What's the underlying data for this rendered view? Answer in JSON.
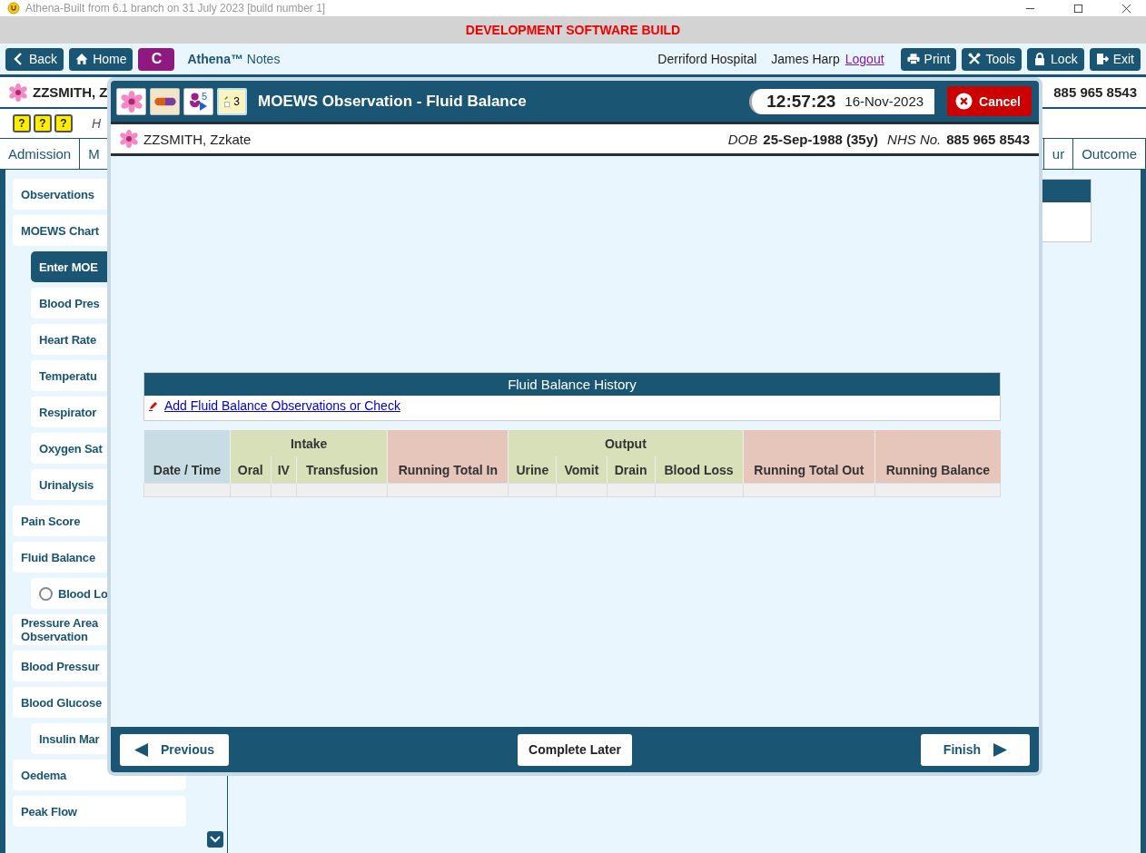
{
  "app_title": "Athena-Built from 6.1 branch on 31 July 2023 [build number 1]",
  "banner": "DEVELOPMENT SOFTWARE BUILD",
  "toolbar": {
    "nav_buttons": [
      {
        "kind": "back",
        "label": "Back"
      },
      {
        "kind": "home",
        "label": "Home"
      }
    ],
    "c_button": "C",
    "brand": "Athena™",
    "brand_suffix": "Notes",
    "hospital": "Derriford Hospital",
    "user": "James Harp",
    "logout": "Logout",
    "actions": [
      {
        "kind": "print",
        "label": "Print"
      },
      {
        "kind": "tools",
        "label": "Tools"
      },
      {
        "kind": "lock",
        "label": "Lock"
      },
      {
        "kind": "exit",
        "label": "Exit"
      }
    ]
  },
  "patient_bar": {
    "name": "ZZSMITH, Z",
    "nhs": "885 965 8543"
  },
  "alert_row": {
    "help_marks": [
      "?",
      "?",
      "?"
    ],
    "note": "H"
  },
  "tabs": [
    {
      "label": "Admission",
      "selected": false
    },
    {
      "label": "M",
      "selected": false
    },
    {
      "label": "ur",
      "selected": false
    },
    {
      "label": "Outcome",
      "selected": false
    }
  ],
  "sidebar": {
    "items": [
      {
        "label": "Observations",
        "selected": false
      },
      {
        "label": "MOEWS Chart",
        "selected": false,
        "children": [
          {
            "label": "Enter MOE",
            "selected": true
          },
          {
            "label": "Blood Pres",
            "selected": false
          },
          {
            "label": "Heart Rate",
            "selected": false
          },
          {
            "label": "Temperatu",
            "selected": false
          },
          {
            "label": "Respirator",
            "selected": false
          },
          {
            "label": "Oxygen Sat",
            "selected": false
          },
          {
            "label": "Urinalysis",
            "selected": false
          }
        ]
      },
      {
        "label": "Pain Score",
        "selected": false
      },
      {
        "label": "Fluid Balance",
        "selected": false,
        "children": [
          {
            "label": "Blood Lo",
            "selected": false,
            "kind": "radio",
            "checked": false
          }
        ]
      },
      {
        "label": "Pressure Area\nObservation",
        "selected": false
      },
      {
        "label": "Blood Pressur",
        "selected": false
      },
      {
        "label": "Blood Glucose",
        "selected": false,
        "children": [
          {
            "label": "Insulin Mar",
            "selected": false
          }
        ]
      },
      {
        "label": "Oedema",
        "selected": false
      },
      {
        "label": "Peak Flow",
        "selected": false
      }
    ]
  },
  "modal": {
    "title": "MOEWS Observation - Fluid Balance",
    "alerts_count": "5",
    "notes_count": "3",
    "time": "12:57:23",
    "date": "16-Nov-2023",
    "cancel": "Cancel",
    "patient": {
      "name": "ZZSMITH, Zzkate",
      "dob_label": "DOB",
      "dob": "25-Sep-1988 (35y)",
      "nhs_label": "NHS No.",
      "nhs": "885 965 8543"
    },
    "history": {
      "title": "Fluid Balance History",
      "link": "Add Fluid Balance Observations or Check"
    },
    "table": {
      "column_groups": [
        {
          "color": "#c8dce4",
          "columns": [
            "Date / Time"
          ]
        },
        {
          "label": "Intake",
          "color": "#d8e0b9",
          "columns": [
            "Oral",
            "IV",
            "Transfusion"
          ]
        },
        {
          "color": "#e6c5bb",
          "columns": [
            "Running Total In"
          ]
        },
        {
          "label": "Output",
          "color": "#d8e0b9",
          "columns": [
            "Urine",
            "Vomit",
            "Drain",
            "Blood Loss"
          ]
        },
        {
          "color": "#e6c5bb",
          "columns": [
            "Running Total Out"
          ]
        },
        {
          "color": "#e6c5bb",
          "columns": [
            "Running Balance"
          ]
        }
      ]
    },
    "footer": {
      "previous": "Previous",
      "complete_later": "Complete Later",
      "finish": "Finish"
    }
  }
}
